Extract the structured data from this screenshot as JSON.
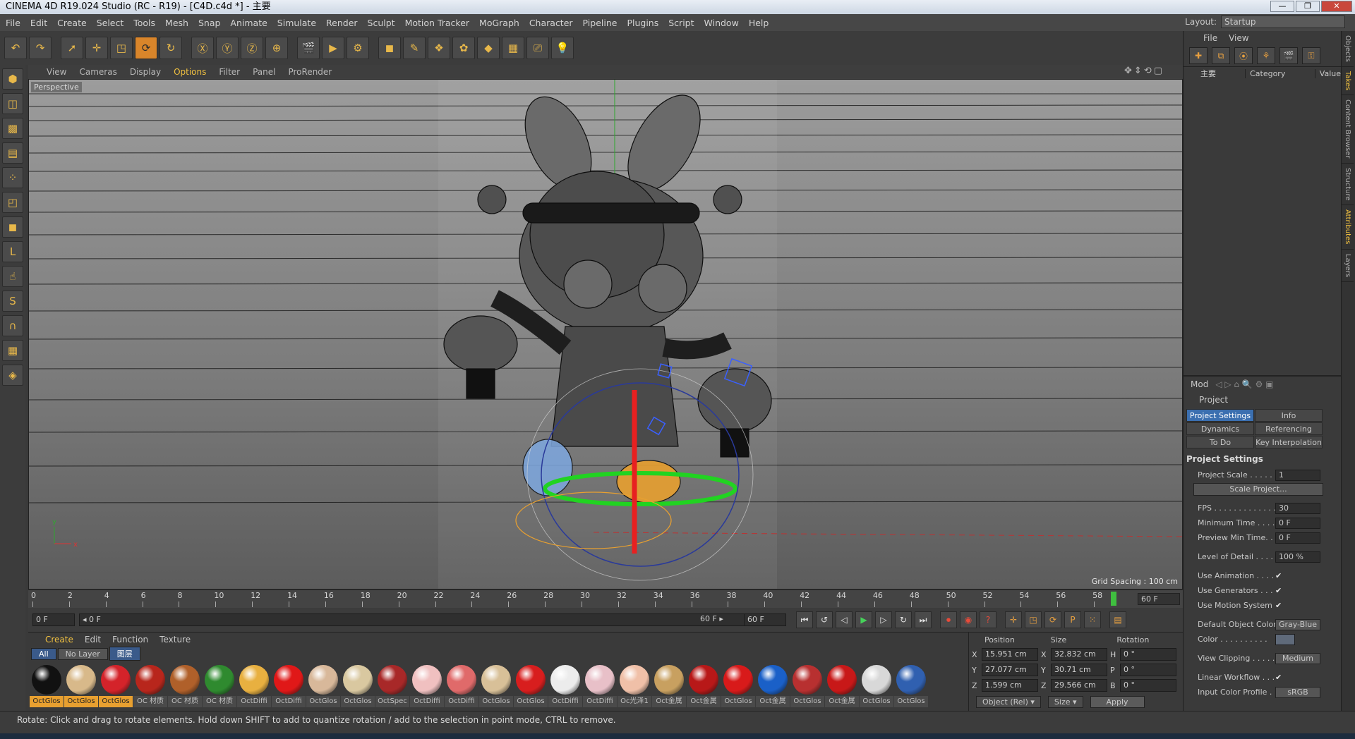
{
  "window": {
    "title": "CINEMA 4D R19.024 Studio (RC - R19) - [C4D.c4d *] - 主要",
    "controls": [
      "—",
      "❐",
      "✕"
    ]
  },
  "menubar": [
    "File",
    "Edit",
    "Create",
    "Select",
    "Tools",
    "Mesh",
    "Snap",
    "Animate",
    "Simulate",
    "Render",
    "Sculpt",
    "Motion Tracker",
    "MoGraph",
    "Character",
    "Pipeline",
    "Plugins",
    "Script",
    "Window",
    "Help"
  ],
  "layout": {
    "label": "Layout:",
    "value": "Startup"
  },
  "viewport": {
    "menu": [
      "View",
      "Cameras",
      "Display",
      "Options",
      "Filter",
      "Panel",
      "ProRender"
    ],
    "highlight": "Options",
    "label": "Perspective",
    "grid_spacing": "Grid Spacing : 100 cm",
    "axes": {
      "x": "x",
      "y": "y"
    }
  },
  "timeline": {
    "ticks": [
      "0",
      "2",
      "4",
      "6",
      "8",
      "10",
      "12",
      "14",
      "16",
      "18",
      "20",
      "22",
      "24",
      "26",
      "28",
      "30",
      "32",
      "34",
      "36",
      "38",
      "40",
      "42",
      "44",
      "46",
      "48",
      "50",
      "52",
      "54",
      "56",
      "58"
    ],
    "end_frame": "60 F"
  },
  "transport": {
    "start": "0 F",
    "range_start": "◂ 0 F",
    "range_end": "60 F ▸",
    "end": "60 F"
  },
  "material_manager": {
    "menu": [
      "Create",
      "Edit",
      "Function",
      "Texture"
    ],
    "highlight": "Create",
    "layers": [
      "All",
      "No Layer",
      "图层"
    ],
    "materials": [
      {
        "name": "OctGlos",
        "color": "#111111",
        "selected": true
      },
      {
        "name": "OctGlos",
        "color": "#d8b98a",
        "selected": true
      },
      {
        "name": "OctGlos",
        "color": "#d4232a",
        "selected": true
      },
      {
        "name": "OC 材质",
        "color": "#b8261c",
        "selected": false
      },
      {
        "name": "OC 材质",
        "color": "#b0602a",
        "selected": false
      },
      {
        "name": "OC 材质",
        "color": "#2f8a2f",
        "selected": false
      },
      {
        "name": "OctDiffi",
        "color": "#e8b040",
        "selected": false
      },
      {
        "name": "OctDiffi",
        "color": "#e01818",
        "selected": false
      },
      {
        "name": "OctGlos",
        "color": "#d8b89a",
        "selected": false
      },
      {
        "name": "OctGlos",
        "color": "#d9c8a0",
        "selected": false
      },
      {
        "name": "OctSpec",
        "color": "#a82828",
        "selected": false
      },
      {
        "name": "OctDiffi",
        "color": "#f0c0c0",
        "selected": false
      },
      {
        "name": "OctDiffi",
        "color": "#e06a6a",
        "selected": false
      },
      {
        "name": "OctGlos",
        "color": "#d8c098",
        "selected": false
      },
      {
        "name": "OctGlos",
        "color": "#d81e1e",
        "selected": false
      },
      {
        "name": "OctDiffi",
        "color": "#ececec",
        "selected": false
      },
      {
        "name": "OctDiffi",
        "color": "#e8c0c8",
        "selected": false
      },
      {
        "name": "Oc光泽1",
        "color": "#f0c0a8",
        "selected": false
      },
      {
        "name": "Oct金属",
        "color": "#c8a060",
        "selected": false
      },
      {
        "name": "Oct金属",
        "color": "#b81818",
        "selected": false
      },
      {
        "name": "OctGlos",
        "color": "#d81a1a",
        "selected": false
      },
      {
        "name": "Oct金属",
        "color": "#1a60c8",
        "selected": false
      },
      {
        "name": "OctGlos",
        "color": "#b83030",
        "selected": false
      },
      {
        "name": "Oct金属",
        "color": "#c81818",
        "selected": false
      },
      {
        "name": "OctGlos",
        "color": "#d8d8d8",
        "selected": false
      },
      {
        "name": "OctGlos",
        "color": "#3060b0",
        "selected": false
      }
    ]
  },
  "coordinates": {
    "headers": [
      "Position",
      "Size",
      "Rotation"
    ],
    "rows": [
      {
        "p_axis": "X",
        "p": "15.951 cm",
        "s_axis": "X",
        "s": "32.832 cm",
        "r_axis": "H",
        "r": "0 °"
      },
      {
        "p_axis": "Y",
        "p": "27.077 cm",
        "s_axis": "Y",
        "s": "30.71 cm",
        "r_axis": "P",
        "r": "0 °"
      },
      {
        "p_axis": "Z",
        "p": "1.599 cm",
        "s_axis": "Z",
        "s": "29.566 cm",
        "r_axis": "B",
        "r": "0 °"
      }
    ],
    "mode": "Object (Rel) ▾",
    "size_mode": "Size ▾",
    "apply": "Apply"
  },
  "status": "Rotate: Click and drag to rotate elements. Hold down SHIFT to add to quantize rotation / add to the selection in point mode, CTRL to remove.",
  "object_manager": {
    "menu": [
      "File",
      "View"
    ],
    "columns": {
      "name": "主要",
      "category": "Category",
      "value": "Value"
    }
  },
  "attributes": {
    "menu": "Mod",
    "object_name": "Project",
    "tabs": [
      "Project Settings",
      "Info",
      "Dynamics",
      "Referencing",
      "To Do",
      "Key Interpolation"
    ],
    "active_tab": "Project Settings",
    "section": "Project Settings",
    "project_scale_label": "Project Scale . . . . . .",
    "project_scale": "1",
    "scale_button": "Scale Project...",
    "fps_label": "FPS . . . . . . . . . . . . .",
    "fps": "30",
    "min_time_label": "Minimum Time . . . . . .",
    "min_time": "0 F",
    "preview_min_label": "Preview Min Time. . . .",
    "preview_min": "0 F",
    "lod_label": "Level of Detail . . . . .",
    "lod": "100 %",
    "use_animation": "Use Animation . . . . .",
    "use_generators": "Use Generators . . . .",
    "use_motion": "Use Motion System",
    "check": "✔",
    "default_color_label": "Default Object Color",
    "default_color": "Gray-Blue",
    "color_label": "Color . . . . . . . . . .",
    "view_clipping_label": "View Clipping . . . . .",
    "view_clipping": "Medium",
    "linear_workflow": "Linear Workflow . . .",
    "input_profile_label": "Input Color Profile . .",
    "input_profile": "sRGB"
  },
  "side_tabs": [
    "Objects",
    "Takes",
    "Content Browser",
    "Structure",
    "Attributes",
    "Layers"
  ]
}
